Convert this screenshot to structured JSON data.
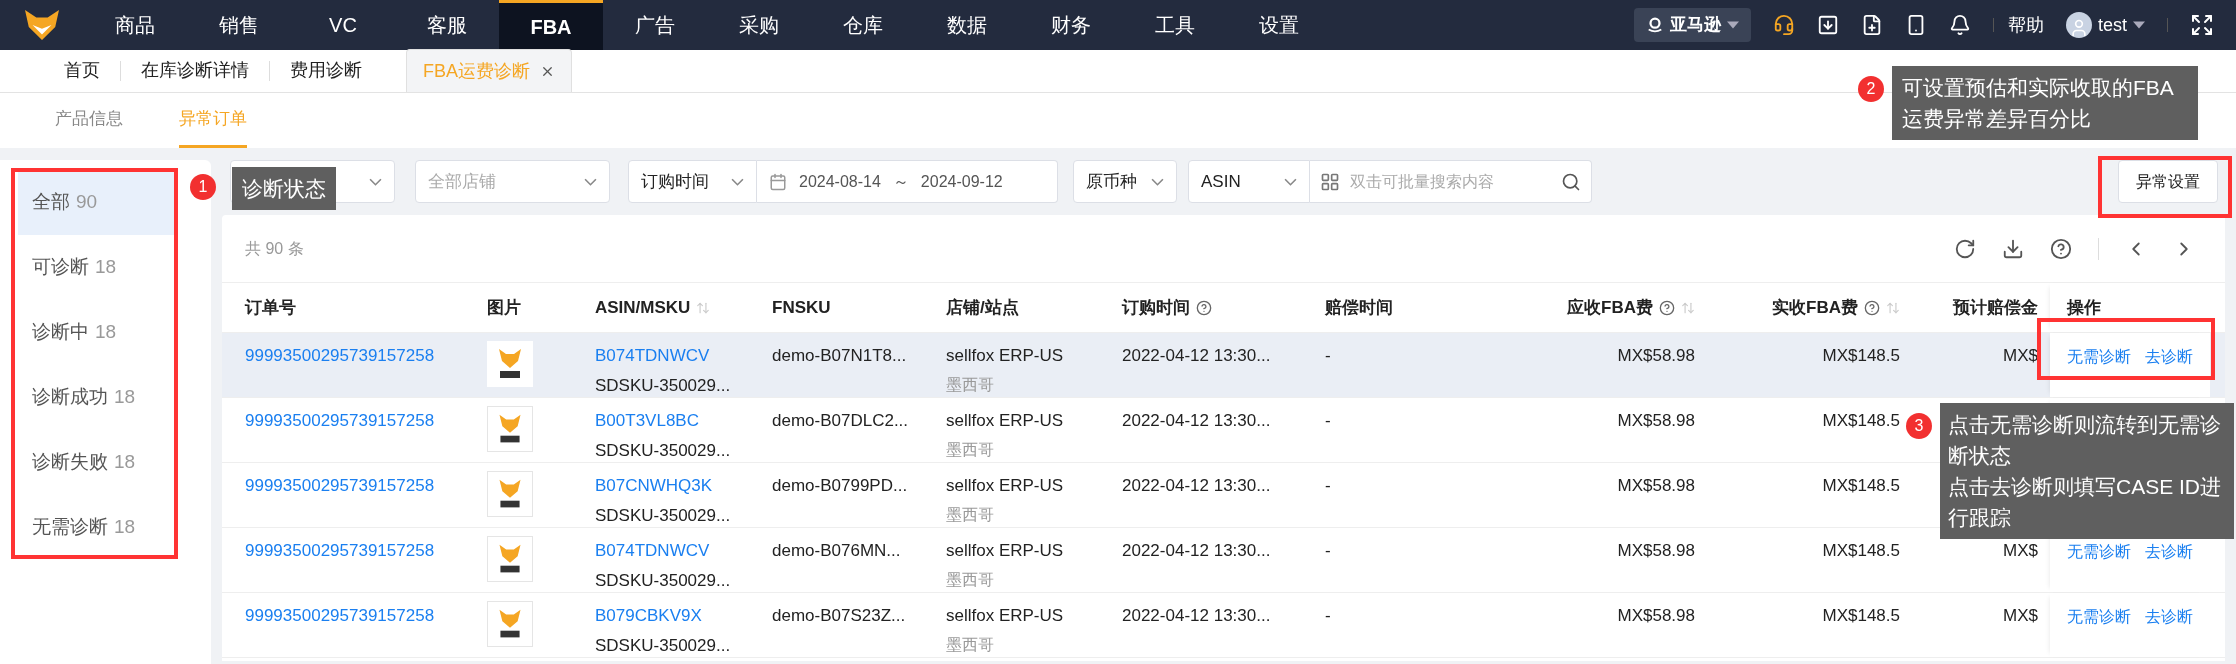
{
  "top_nav": {
    "items": [
      {
        "label": "商品",
        "selected": false
      },
      {
        "label": "销售",
        "selected": false
      },
      {
        "label": "VC",
        "selected": false
      },
      {
        "label": "客服",
        "selected": false
      },
      {
        "label": "FBA",
        "selected": true
      },
      {
        "label": "广告",
        "selected": false
      },
      {
        "label": "采购",
        "selected": false
      },
      {
        "label": "仓库",
        "selected": false
      },
      {
        "label": "数据",
        "selected": false
      },
      {
        "label": "财务",
        "selected": false
      },
      {
        "label": "工具",
        "selected": false
      },
      {
        "label": "设置",
        "selected": false
      }
    ],
    "platform": "亚马逊",
    "help": "帮助",
    "user": "test"
  },
  "page_tabs": [
    {
      "label": "首页",
      "selected": false,
      "closable": false
    },
    {
      "label": "在库诊断详情",
      "selected": false,
      "closable": false
    },
    {
      "label": "费用诊断",
      "selected": false,
      "closable": false
    },
    {
      "label": "FBA运费诊断",
      "selected": true,
      "closable": true
    }
  ],
  "sub_tabs": [
    {
      "label": "产品信息",
      "selected": false
    },
    {
      "label": "异常订单",
      "selected": true
    }
  ],
  "status_filter": [
    {
      "label": "全部",
      "count": "90",
      "selected": true
    },
    {
      "label": "可诊断",
      "count": "18",
      "selected": false
    },
    {
      "label": "诊断中",
      "count": "18",
      "selected": false
    },
    {
      "label": "诊断成功",
      "count": "18",
      "selected": false
    },
    {
      "label": "诊断失败",
      "count": "18",
      "selected": false
    },
    {
      "label": "无需诊断",
      "count": "18",
      "selected": false
    }
  ],
  "filters": {
    "store": {
      "placeholder": "全部店铺"
    },
    "date_type": "订购时间",
    "date_start": "2024-08-14",
    "date_separator": "～",
    "date_end": "2024-09-12",
    "currency": "原币种",
    "search_type": "ASIN",
    "search": {
      "placeholder": "双击可批量搜索内容"
    }
  },
  "settings_button": "异常设置",
  "table": {
    "total": "共 90 条",
    "columns": [
      {
        "label": "订单号",
        "help": false,
        "sortable": false
      },
      {
        "label": "图片",
        "help": false,
        "sortable": false
      },
      {
        "label": "ASIN/MSKU",
        "help": false,
        "sortable": true
      },
      {
        "label": "FNSKU",
        "help": false,
        "sortable": false
      },
      {
        "label": "店铺/站点",
        "help": false,
        "sortable": false
      },
      {
        "label": "订购时间",
        "help": true,
        "sortable": false
      },
      {
        "label": "赔偿时间",
        "help": false,
        "sortable": false
      },
      {
        "label": "应收FBA费",
        "help": true,
        "sortable": true
      },
      {
        "label": "实收FBA费",
        "help": true,
        "sortable": true
      },
      {
        "label": "预计赔偿金",
        "help": false,
        "sortable": false
      },
      {
        "label": "操作",
        "help": false,
        "sortable": false
      }
    ],
    "rows": [
      {
        "highlighted": true,
        "order_no": "99993500295739157258",
        "asin": "B074TDNWCV",
        "msku": "SDSKU-350029...",
        "fnsku": "demo-B07N1T8...",
        "shop": "sellfox ERP-US",
        "site": "墨西哥",
        "order_time": "2022-04-12 13:30...",
        "compensation_time": "-",
        "due_fee": "MX$58.98",
        "actual_fee": "MX$148.5",
        "compensation": "MX$",
        "actions": [
          "无需诊断",
          "去诊断"
        ]
      },
      {
        "highlighted": false,
        "order_no": "99993500295739157258",
        "asin": "B00T3VL8BC",
        "msku": "SDSKU-350029...",
        "fnsku": "demo-B07DLC2...",
        "shop": "sellfox ERP-US",
        "site": "墨西哥",
        "order_time": "2022-04-12 13:30...",
        "compensation_time": "-",
        "due_fee": "MX$58.98",
        "actual_fee": "MX$148.5"
      },
      {
        "highlighted": false,
        "order_no": "99993500295739157258",
        "asin": "B07CNWHQ3K",
        "msku": "SDSKU-350029...",
        "fnsku": "demo-B0799PD...",
        "shop": "sellfox ERP-US",
        "site": "墨西哥",
        "order_time": "2022-04-12 13:30...",
        "compensation_time": "-",
        "due_fee": "MX$58.98",
        "actual_fee": "MX$148.5"
      },
      {
        "highlighted": false,
        "order_no": "99993500295739157258",
        "asin": "B074TDNWCV",
        "msku": "SDSKU-350029...",
        "fnsku": "demo-B076MN...",
        "shop": "sellfox ERP-US",
        "site": "墨西哥",
        "order_time": "2022-04-12 13:30...",
        "compensation_time": "-",
        "due_fee": "MX$58.98",
        "actual_fee": "MX$148.5",
        "compensation": "MX$",
        "actions": [
          "无需诊断",
          "去诊断"
        ]
      },
      {
        "highlighted": false,
        "order_no": "99993500295739157258",
        "asin": "B079CBKV9X",
        "msku": "SDSKU-350029...",
        "fnsku": "demo-B07S23Z...",
        "shop": "sellfox ERP-US",
        "site": "墨西哥",
        "order_time": "2022-04-12 13:30...",
        "compensation_time": "-",
        "due_fee": "MX$58.98",
        "actual_fee": "MX$148.5",
        "compensation": "MX$",
        "actions": [
          "无需诊断",
          "去诊断"
        ]
      }
    ]
  },
  "annotations": [
    {
      "number": "1",
      "lines": [
        "诊断状态"
      ]
    },
    {
      "number": "2",
      "lines": [
        "可设置预估和实际收取的FBA",
        "运费异常差异百分比"
      ]
    },
    {
      "number": "3",
      "lines": [
        "点击无需诊断则流转到无需诊断状态",
        "点击去诊断则填写CASE ID进行跟踪"
      ]
    }
  ]
}
